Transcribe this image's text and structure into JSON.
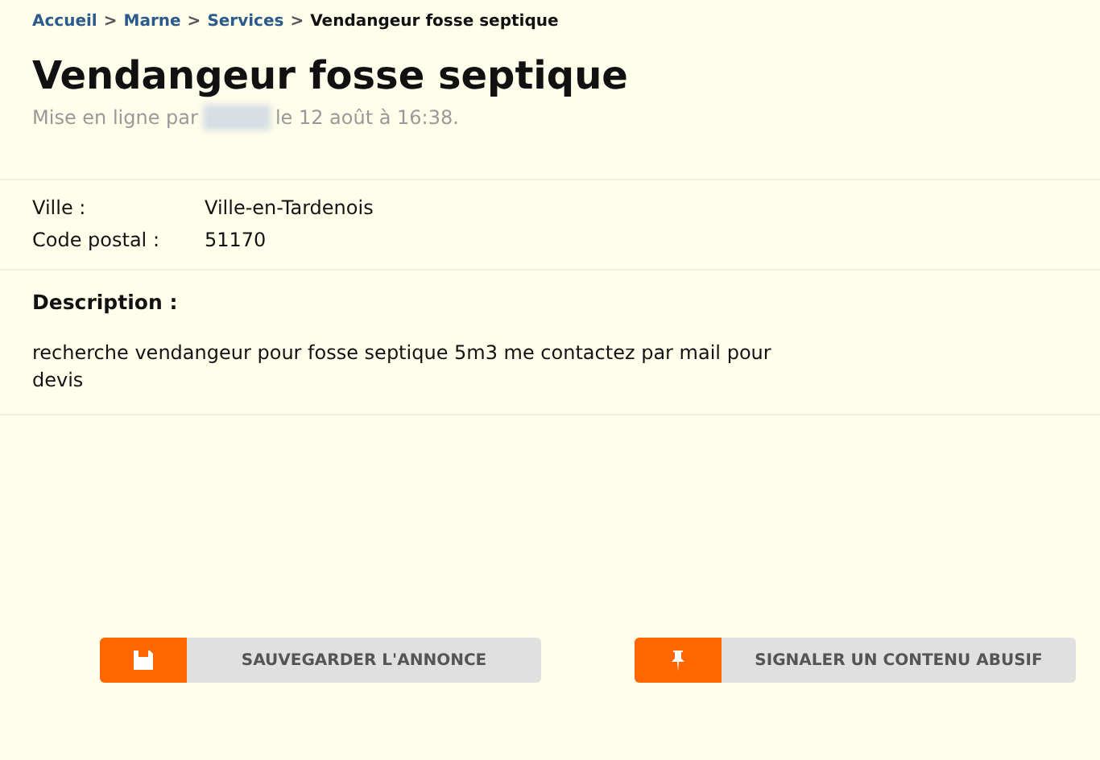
{
  "breadcrumb": [
    {
      "label": "Accueil",
      "kind": "link"
    },
    {
      "label": "Marne",
      "kind": "link"
    },
    {
      "label": "Services",
      "kind": "link"
    },
    {
      "label": "Vendangeur fosse septique",
      "kind": "current"
    }
  ],
  "breadcrumb_separator": ">",
  "title": "Vendangeur fosse septique",
  "posted": {
    "prefix": "Mise en ligne par",
    "suffix": "le 12 août à 16:38."
  },
  "details": [
    {
      "label": "Ville :",
      "value": "Ville-en-Tardenois"
    },
    {
      "label": "Code postal :",
      "value": "51170"
    }
  ],
  "description": {
    "heading": "Description :",
    "text": "recherche vendangeur pour fosse septique 5m3 me contactez par mail pour devis"
  },
  "buttons": [
    {
      "label": "SAUVEGARDER L'ANNONCE",
      "kind": "save"
    },
    {
      "label": "SIGNALER UN CONTENU ABUSIF",
      "kind": "report"
    }
  ]
}
